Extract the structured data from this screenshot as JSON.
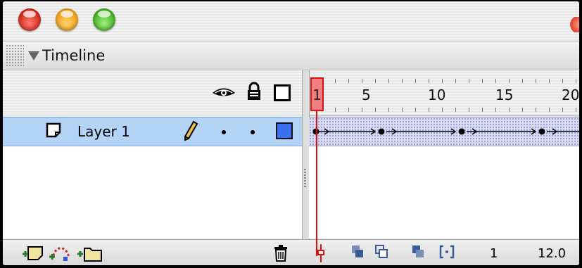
{
  "window": {
    "title_lights": [
      "close",
      "minimize",
      "zoom"
    ]
  },
  "panel": {
    "title": "Timeline"
  },
  "header_icons": [
    "eye-icon",
    "lock-icon",
    "outline-icon"
  ],
  "ruler": {
    "labels": [
      "1",
      "5",
      "10",
      "15",
      "20"
    ],
    "current_frame_label": "1"
  },
  "layers": [
    {
      "name": "Layer 1",
      "color": "#3a6ff0",
      "selected": true
    }
  ],
  "tween": {
    "type": "motion",
    "keyframes": [
      1,
      6,
      12,
      18
    ]
  },
  "status": {
    "current_frame": "1",
    "fps": "12.0"
  },
  "colors": {
    "selection": "#b3d3f7",
    "playhead": "#e01010",
    "tween_fill": "#d9dcf4"
  }
}
